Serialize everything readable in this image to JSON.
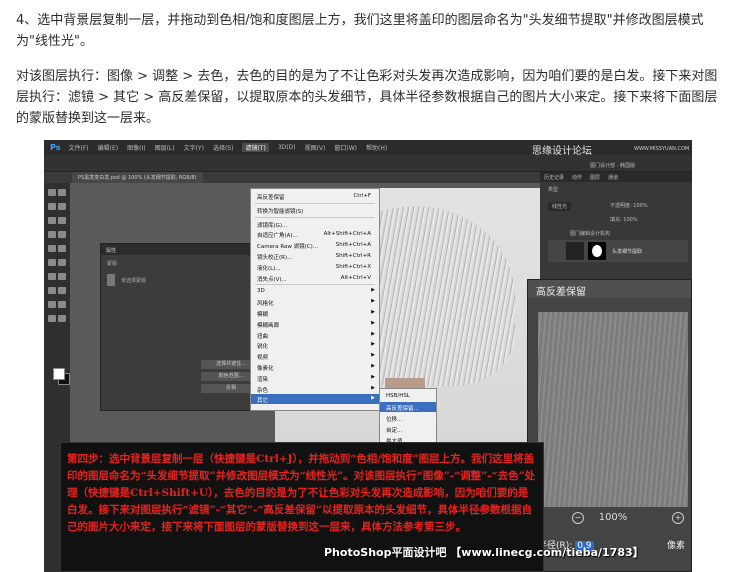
{
  "article": {
    "para1": "4、选中背景层复制一层，并拖动到色相/饱和度图层上方，我们这里将盖印的图层命名为\"头发细节提取\"并修改图层模式为\"线性光\"。",
    "para2": "对该图层执行：图像 > 调整 > 去色，去色的目的是为了不让色彩对头发再次造成影响，因为咱们要的是白发。接下来对图层执行：滤镜 > 其它 > 高反差保留，以提取原本的头发细节，具体半径参数根据自己的图片大小来定。接下来将下面图层的蒙版替换到这一层来。"
  },
  "ps": {
    "menubar": [
      "文件(F)",
      "编辑(E)",
      "图像(I)",
      "图层(L)",
      "文字(Y)",
      "选择(S)",
      "滤镜(T)",
      "3D(D)",
      "视图(V)",
      "窗口(W)",
      "帮助(H)"
    ],
    "active_menu": "滤镜(T)",
    "watermark_top": "思缘设计论坛",
    "watermark_top_url": "WWW.MISSYUAN.COM",
    "doc_tab": "PS黑发变白发.psd @ 100% (头发细节提取, RGB/8)",
    "props_header": "属性",
    "props_item": "蒙版",
    "props_mask_label": "未选择蒙版",
    "props_buttons": [
      "选择并遮住...",
      "颜色范围...",
      "反相"
    ],
    "filter_menu": [
      {
        "label": "高反差保留",
        "shortcut": "Ctrl+F",
        "arrow": false
      },
      {
        "label": "转换为智能滤镜(S)",
        "shortcut": "",
        "arrow": false
      },
      {
        "label": "滤镜库(G)...",
        "shortcut": "",
        "arrow": false
      },
      {
        "label": "自适应广角(A)...",
        "shortcut": "Alt+Shift+Ctrl+A",
        "arrow": false
      },
      {
        "label": "Camera Raw 滤镜(C)...",
        "shortcut": "Shift+Ctrl+A",
        "arrow": false
      },
      {
        "label": "镜头校正(R)...",
        "shortcut": "Shift+Ctrl+R",
        "arrow": false
      },
      {
        "label": "液化(L)...",
        "shortcut": "Shift+Ctrl+X",
        "arrow": false
      },
      {
        "label": "消失点(V)...",
        "shortcut": "Alt+Ctrl+V",
        "arrow": false
      },
      {
        "label": "3D",
        "shortcut": "",
        "arrow": true
      },
      {
        "label": "风格化",
        "shortcut": "",
        "arrow": true
      },
      {
        "label": "模糊",
        "shortcut": "",
        "arrow": true
      },
      {
        "label": "模糊画廊",
        "shortcut": "",
        "arrow": true
      },
      {
        "label": "扭曲",
        "shortcut": "",
        "arrow": true
      },
      {
        "label": "锐化",
        "shortcut": "",
        "arrow": true
      },
      {
        "label": "视频",
        "shortcut": "",
        "arrow": true
      },
      {
        "label": "像素化",
        "shortcut": "",
        "arrow": true
      },
      {
        "label": "渲染",
        "shortcut": "",
        "arrow": true
      },
      {
        "label": "杂色",
        "shortcut": "",
        "arrow": true
      },
      {
        "label": "其它",
        "shortcut": "",
        "arrow": true
      }
    ],
    "other_submenu": [
      "HSB/HSL",
      "高反差保留...",
      "位移...",
      "自定...",
      "最大值...",
      "最小值..."
    ],
    "rpanel_tabs": [
      "历史记录",
      "动作",
      "图层",
      "通道"
    ],
    "layer_kind": "类型",
    "layer_mode": "线性光",
    "layer_opacity_label": "不透明度: 100%",
    "layer_fill_label": "填充: 100%",
    "layer_group": "图门编辑设计机构",
    "layer_name": "头发细节提取",
    "watermark_right": "图门设计部 - 韩国版",
    "dialog": {
      "title": "高反差保留",
      "zoom": "100%",
      "radius_label": "半径(R):",
      "radius_value": "0.9",
      "unit": "像素"
    }
  },
  "caption": {
    "text": "第四步：选中背景层复制一层（快捷键是Ctrl+J），并拖动到“色相/饱和度”图层上方。我们这里将盖印的图层命名为“头发细节提取”并修改图层模式为“线性光”。对该图层执行“图像”-“调整”-“去色”处理（快捷键是Ctrl+Shift+U），去色的目的是为了不让色彩对头发再次造成影响，因为咱们要的是白发。接下来对图层执行“滤镜”-“其它”-“高反差保留”以提取原本的头发细节，具体半径参数根据自己的图片大小来定，接下来将下面图层的蒙版替换到这一层来，具体方法参考第三步。",
    "footer": "PhotoShop平面设计吧 【www.linecg.com/tieba/1783】"
  },
  "colors": {
    "caption_red": "#e4231e",
    "menu_highlight": "#3b6ebf",
    "ps_dark": "#3a3a3a"
  }
}
